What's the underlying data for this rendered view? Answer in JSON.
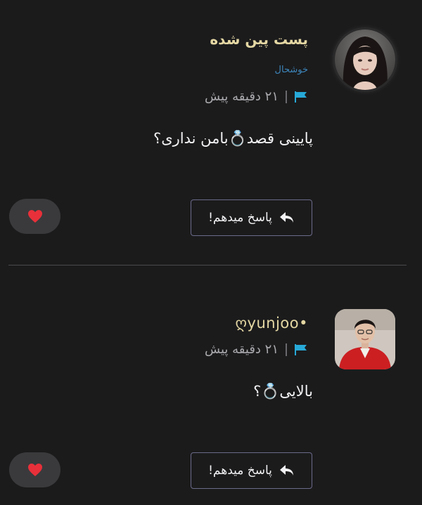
{
  "posts": [
    {
      "username": "پست پین شده",
      "flair": "خوشحال",
      "time": "۲۱ دقیقه پیش",
      "body": "پایینی قصد💍بامن نداری؟",
      "reply_label": "پاسخ میدهم!"
    },
    {
      "username": "•ღyunjoo",
      "time": "۲۱ دقیقه پیش",
      "body": "بالایی💍؟",
      "reply_label": "پاسخ میدهم!"
    }
  ],
  "icons": {
    "flag": "flag-icon",
    "reply": "reply-arrow-icon",
    "like": "heart-icon"
  },
  "colors": {
    "background": "#1b1b1c",
    "username": "#e4d7a3",
    "flair": "#3d86bb",
    "flag": "#27a9d8",
    "heart": "#e8303a",
    "like_pill": "#3a3a3c",
    "reply_border": "#6b6a8a"
  }
}
